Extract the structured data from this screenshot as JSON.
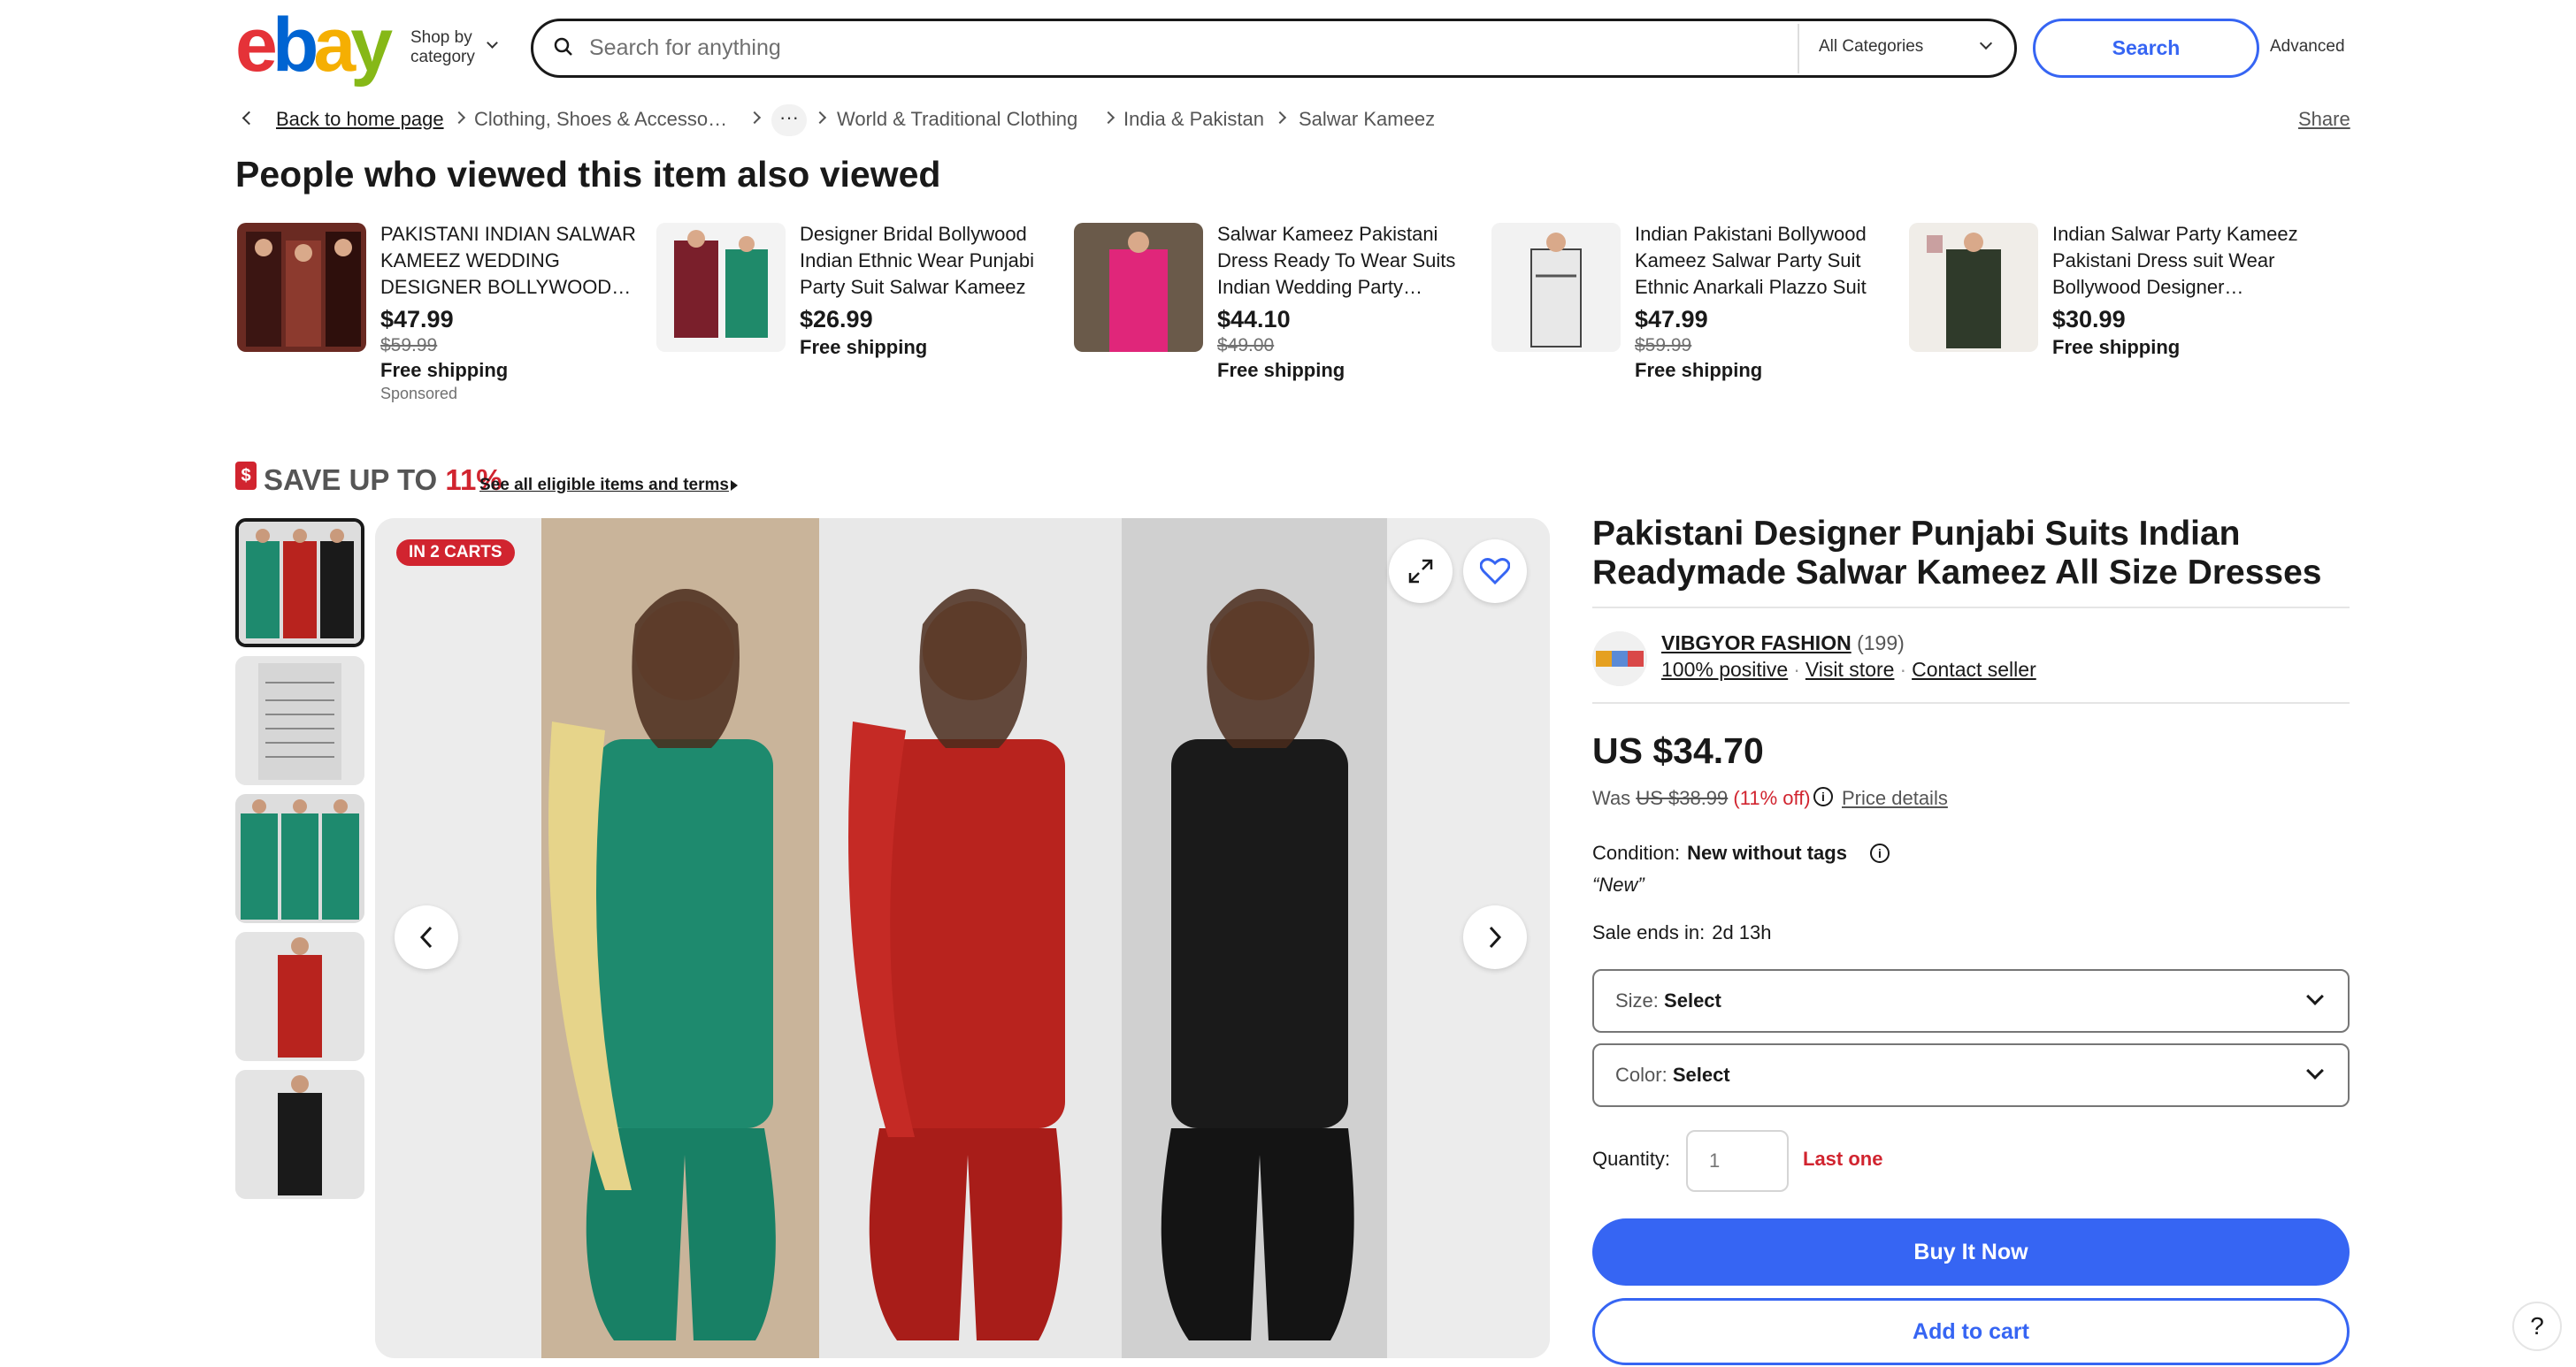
{
  "header": {
    "logo_letters": [
      "e",
      "b",
      "a",
      "y"
    ],
    "shop_by_line1": "Shop by",
    "shop_by_line2": "category",
    "search_placeholder": "Search for anything",
    "category_select": "All Categories",
    "search_button": "Search",
    "advanced": "Advanced"
  },
  "breadcrumb": {
    "back": "Back to home page",
    "items": [
      "Clothing, Shoes & Accesso…",
      "World & Traditional Clothing",
      "India & Pakistan",
      "Salwar Kameez"
    ],
    "more": "···",
    "share": "Share"
  },
  "people_also_viewed": {
    "title": "People who viewed this item also viewed",
    "items": [
      {
        "name": "PAKISTANI INDIAN SALWAR KAMEEZ WEDDING DESIGNER BOLLYWOOD…",
        "price": "$47.99",
        "was": "$59.99",
        "shipping": "Free shipping",
        "sponsored": "Sponsored"
      },
      {
        "name": "Designer Bridal Bollywood Indian Ethnic Wear Punjabi Party Suit Salwar Kameez",
        "price": "$26.99",
        "was": "",
        "shipping": "Free shipping",
        "sponsored": ""
      },
      {
        "name": "Salwar Kameez Pakistani Dress Ready To Wear Suits Indian Wedding Party…",
        "price": "$44.10",
        "was": "$49.00",
        "shipping": "Free shipping",
        "sponsored": ""
      },
      {
        "name": "Indian Pakistani Bollywood Kameez Salwar Party Suit Ethnic Anarkali Plazzo Suit",
        "price": "$47.99",
        "was": "$59.99",
        "shipping": "Free shipping",
        "sponsored": ""
      },
      {
        "name": "Indian Salwar Party Kameez Pakistani Dress suit Wear Bollywood Designer…",
        "price": "$30.99",
        "was": "",
        "shipping": "Free shipping",
        "sponsored": ""
      }
    ]
  },
  "save_banner": {
    "icon": "$",
    "text": "SAVE UP TO ",
    "percent": "11%",
    "link": "See all eligible items and terms"
  },
  "gallery": {
    "badge": "IN 2 CARTS",
    "thumbnails": [
      "green-red-black suits",
      "size chart",
      "three green suits",
      "red suit",
      "black suit"
    ],
    "main_colors": [
      "#1e8a6e",
      "#b8231e",
      "#1a1a1a"
    ]
  },
  "product": {
    "title": "Pakistani Designer Punjabi Suits Indian Readymade Salwar Kameez All Size Dresses",
    "seller_name": "VIBGYOR FASHION",
    "seller_count": "(199)",
    "seller_positive": "100% positive",
    "visit_store": "Visit store",
    "contact_seller": "Contact seller",
    "price": "US $34.70",
    "was_label": "Was",
    "was_price": "US $38.99",
    "off": "(11% off)",
    "price_details": "Price details",
    "condition_label": "Condition:",
    "condition_value": "New without tags",
    "condition_note": "“New”",
    "sale_label": "Sale ends in:",
    "sale_value": "2d 13h",
    "size_label": "Size:",
    "size_value": "Select",
    "color_label": "Color:",
    "color_value": "Select",
    "quantity_label": "Quantity:",
    "quantity_value": "1",
    "stock_note": "Last one",
    "buy_now": "Buy It Now",
    "add_to_cart": "Add to cart"
  },
  "help": "?"
}
